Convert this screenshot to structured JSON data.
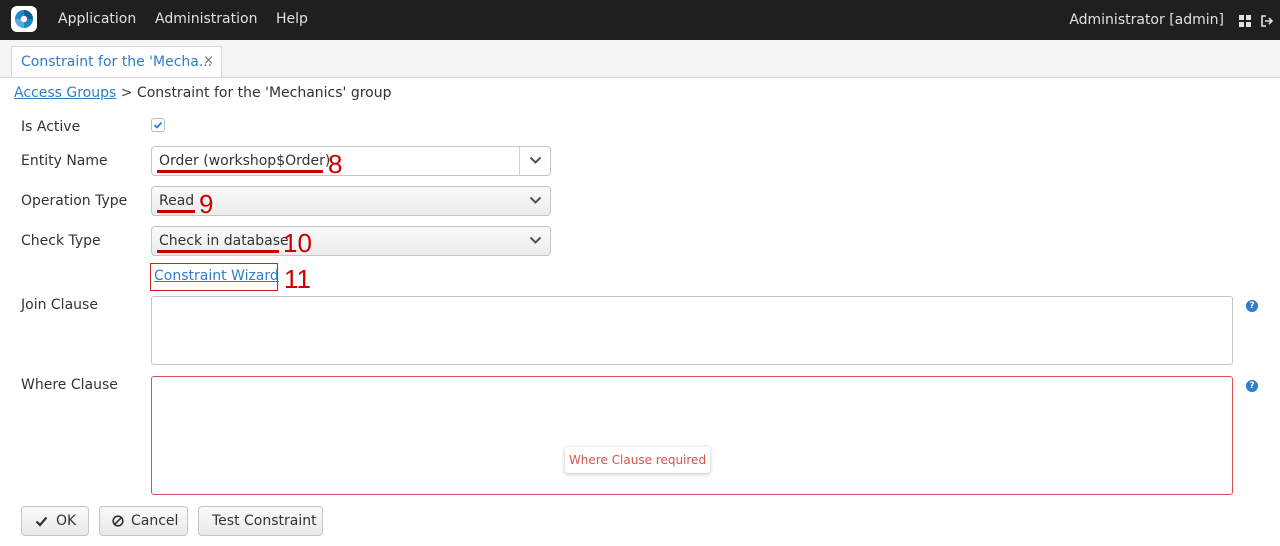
{
  "topbar": {
    "menu": [
      "Application",
      "Administration",
      "Help"
    ],
    "user": "Administrator [admin]",
    "icons": [
      "app-logo-icon",
      "grid-icon",
      "logout-icon"
    ]
  },
  "tab": {
    "label": "Constraint for the 'Mecha...",
    "close": "×"
  },
  "breadcrumb": {
    "link": "Access Groups",
    "separator": ">",
    "current": "Constraint for the 'Mechanics' group"
  },
  "form": {
    "is_active_label": "Is Active",
    "is_active": true,
    "entity_name_label": "Entity Name",
    "entity_name_value": "Order (workshop$Order)",
    "operation_type_label": "Operation Type",
    "operation_type_value": "Read",
    "check_type_label": "Check Type",
    "check_type_value": "Check in database",
    "wizard_link": "Constraint Wizard",
    "join_clause_label": "Join Clause",
    "join_clause_value": "",
    "where_clause_label": "Where Clause",
    "where_clause_value": "",
    "where_error": "Where Clause required"
  },
  "annotations": [
    "8",
    "9",
    "10",
    "11"
  ],
  "buttons": {
    "ok": "OK",
    "cancel": "Cancel",
    "test": "Test Constraint"
  },
  "colors": {
    "topbar": "#1f1f1f",
    "link": "#2d7dc8",
    "annotation": "#cc0000",
    "error": "#d9534f"
  }
}
